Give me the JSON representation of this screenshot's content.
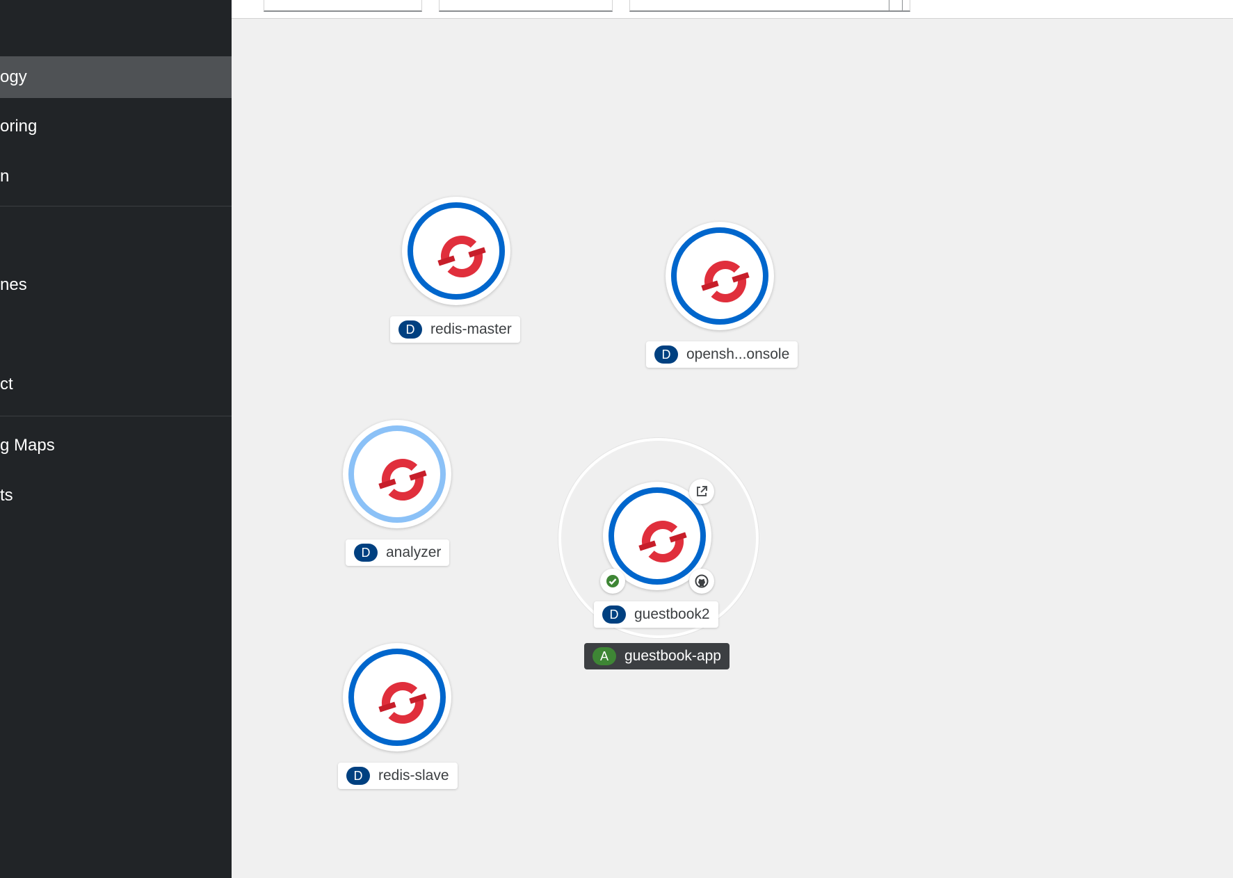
{
  "sidebar": {
    "items": [
      {
        "label": "ogy",
        "active": true
      },
      {
        "label": "oring"
      },
      {
        "label": "n"
      },
      {
        "label": "nes"
      },
      {
        "label": "ct"
      },
      {
        "label": "g Maps"
      },
      {
        "label": "ts"
      }
    ]
  },
  "toolbar": {
    "fields": [
      "",
      "",
      ""
    ]
  },
  "topology": {
    "nodes": [
      {
        "name": "redis-master",
        "kind": "D",
        "icon": "openshift-logo-icon"
      },
      {
        "name": "opensh...onsole",
        "kind": "D",
        "icon": "openshift-logo-icon"
      },
      {
        "name": "analyzer",
        "kind": "D",
        "icon": "openshift-logo-icon"
      },
      {
        "name": "guestbook2",
        "kind": "D",
        "icon": "openshift-logo-icon"
      },
      {
        "name": "redis-slave",
        "kind": "D",
        "icon": "openshift-logo-icon"
      }
    ],
    "application": {
      "name": "guestbook-app",
      "kind": "A"
    },
    "decorators": [
      "external-link-icon",
      "status-check-icon",
      "github-icon"
    ]
  },
  "colors": {
    "sidebar_bg": "#212427",
    "active_item_bg": "#4f5255",
    "canvas_bg": "#f0f0f0",
    "ring_blue": "#0066cc",
    "ring_light_blue": "#8bc1f7",
    "logo_red": "#e02f3c",
    "badge_blue": "#004080",
    "badge_green": "#3e8635"
  }
}
